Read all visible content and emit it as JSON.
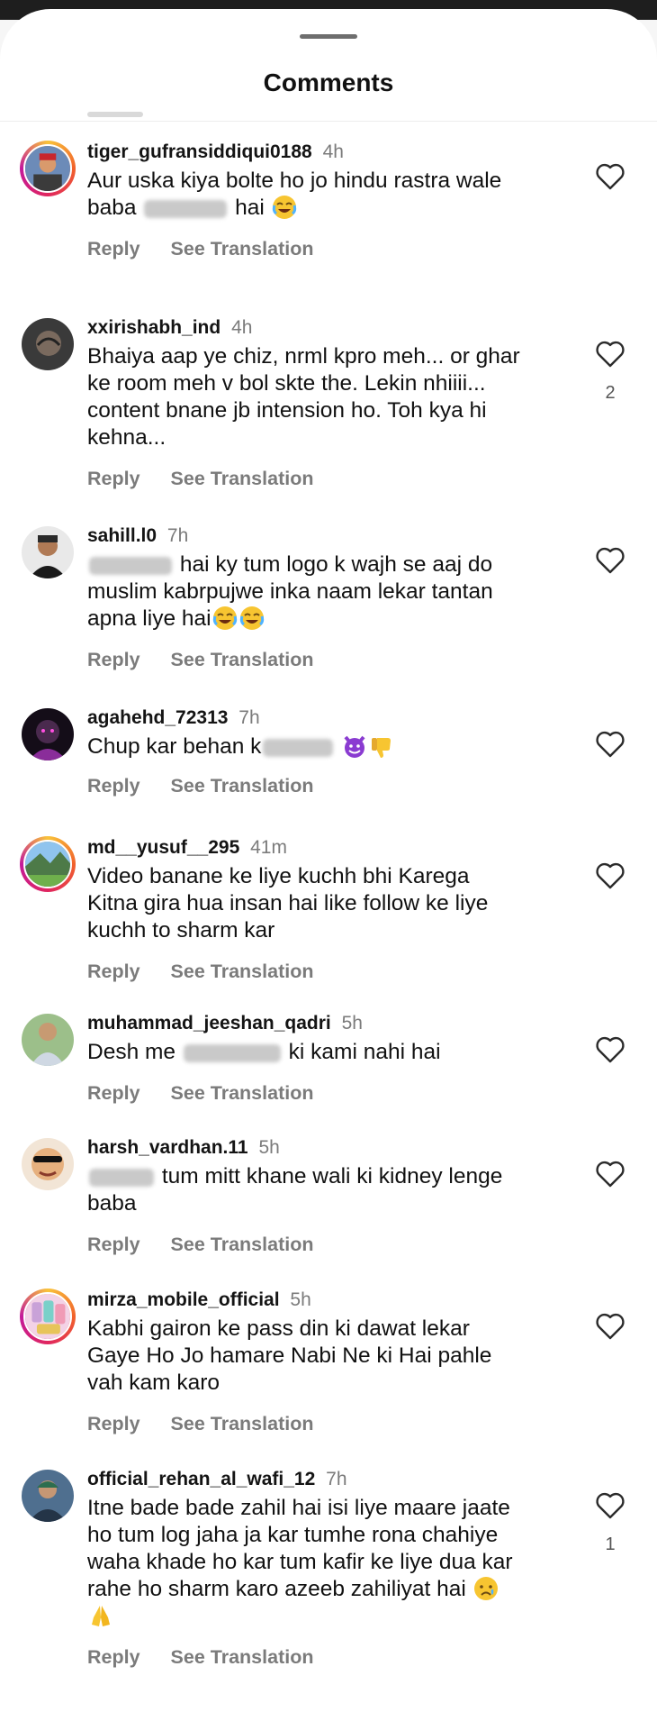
{
  "header": {
    "title": "Comments"
  },
  "actions": {
    "reply_label": "Reply",
    "translate_label": "See Translation"
  },
  "comments": [
    {
      "username": "tiger_gufransiddiqui0188",
      "time": "4h",
      "lines": [
        "Aur uska kiya bolte ho jo hindu rastra wale",
        "baba",
        "hai"
      ],
      "like_count": ""
    },
    {
      "username": "xxirishabh_ind",
      "time": "4h",
      "lines": [
        "Bhaiya aap ye chiz, nrml kpro meh... or ghar",
        "ke room meh v bol skte the. Lekin nhiiii...",
        "content bnane jb intension ho. Toh kya hi",
        "kehna..."
      ],
      "like_count": "2"
    },
    {
      "username": "sahill.l0",
      "time": "7h",
      "lines": [
        "hai ky tum logo k wajh se aaj do",
        "muslim kabrpujwe inka naam lekar tantan",
        "apna liye hai"
      ],
      "like_count": ""
    },
    {
      "username": "agahehd_72313",
      "time": "7h",
      "lines": [
        "Chup kar behan k"
      ],
      "like_count": ""
    },
    {
      "username": "md__yusuf__295",
      "time": "41m",
      "lines": [
        "Video banane ke liye kuchh bhi Karega",
        "Kitna gira hua insan hai like follow ke liye",
        "kuchh to sharm kar"
      ],
      "like_count": ""
    },
    {
      "username": "muhammad_jeeshan_qadri",
      "time": "5h",
      "lines": [
        "Desh me",
        "ki kami nahi hai"
      ],
      "like_count": ""
    },
    {
      "username": "harsh_vardhan.11",
      "time": "5h",
      "lines": [
        "tum mitt khane wali ki kidney lenge",
        "baba"
      ],
      "like_count": ""
    },
    {
      "username": "mirza_mobile_official",
      "time": "5h",
      "lines": [
        "Kabhi gairon ke pass din ki dawat lekar",
        "Gaye Ho Jo hamare Nabi Ne ki Hai pahle",
        "vah kam karo"
      ],
      "like_count": ""
    },
    {
      "username": "official_rehan_al_wafi_12",
      "time": "7h",
      "lines": [
        "Itne bade bade zahil hai isi liye maare jaate",
        "ho tum log jaha ja kar tumhe rona chahiye",
        "waha khade ho kar tum kafir ke liye dua kar",
        "rahe ho sharm karo azeeb zahiliyat hai"
      ],
      "like_count": "1"
    }
  ],
  "icons": {
    "like": "heart-outline-icon",
    "emoji_laugh": "face-with-tears-of-joy-icon",
    "emoji_devil": "smiling-face-with-horns-icon",
    "emoji_thumbs": "thumbs-down-icon",
    "emoji_cry": "crying-face-icon",
    "emoji_pray": "folded-hands-icon"
  },
  "colors": {
    "background": "#ffffff",
    "muted": "#7b7b7b",
    "ring": "#e0265f"
  }
}
